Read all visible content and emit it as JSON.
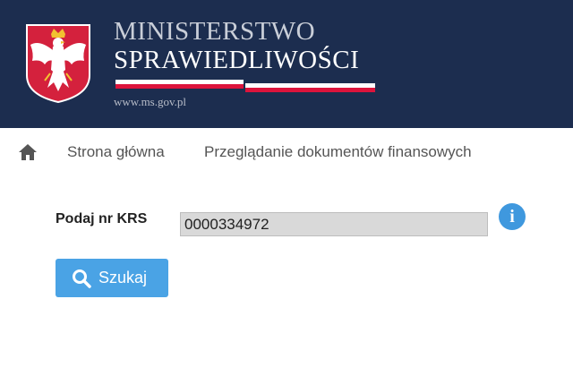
{
  "header": {
    "title_line1": "MINISTERSTWO",
    "title_line2": "SPRAWIEDLIWOŚCI",
    "url": "www.ms.gov.pl",
    "background_color": "#1c2d4f",
    "emblem_icon": "polish-eagle-emblem",
    "flag_colors": [
      "#ffffff",
      "#dc143c"
    ]
  },
  "breadcrumb": {
    "home_icon": "home-icon",
    "items": [
      {
        "label": "Strona główna"
      },
      {
        "label": "Przeglądanie dokumentów finansowych"
      }
    ]
  },
  "form": {
    "krs_label": "Podaj nr KRS",
    "krs_value": "0000334972",
    "info_glyph": "i",
    "info_color": "#3f98de",
    "search_label": "Szukaj",
    "search_icon": "search-icon",
    "search_color": "#4aa3e5"
  }
}
